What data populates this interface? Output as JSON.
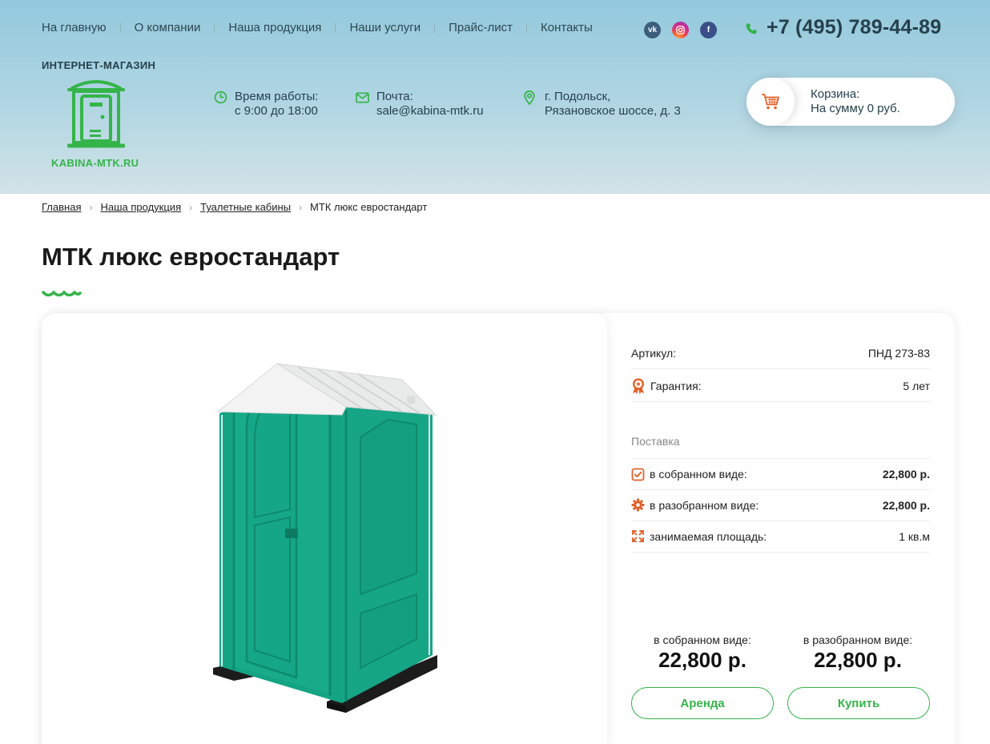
{
  "nav": {
    "items": [
      {
        "label": "На главную"
      },
      {
        "label": "О компании"
      },
      {
        "label": "Наша продукция"
      },
      {
        "label": "Наши услуги"
      },
      {
        "label": "Прайс-лист"
      },
      {
        "label": "Контакты"
      }
    ]
  },
  "social": {
    "vk": "vk",
    "instagram": "instagram-icon",
    "facebook": "f"
  },
  "phone": "+7 (495) 789-44-89",
  "logo": {
    "caption": "ИНТЕРНЕТ-МАГАЗИН",
    "text": "KABINA-MTK.RU",
    "color": "#35b44a"
  },
  "info": {
    "hours_label": "Время работы:",
    "hours_value": "с 9:00 до 18:00",
    "mail_label": "Почта:",
    "mail_value": "sale@kabina-mtk.ru",
    "addr_line1": "г. Подольск,",
    "addr_line2": "Рязановское шоссе, д. 3"
  },
  "cart": {
    "title": "Корзина:",
    "sum": "На сумму 0 руб."
  },
  "breadcrumb": [
    "Главная",
    "Наша продукция",
    "Туалетные кабины",
    "МТК люкс евростандарт"
  ],
  "product": {
    "title": "МТК люкс евростандарт",
    "article_label": "Артикул:",
    "article_value": "ПНД 273-83",
    "warranty_label": "Гарантия:",
    "warranty_value": "5 лет",
    "supply_label": "Поставка",
    "assembled_label": "в собранном виде:",
    "assembled_value": "22,800 р.",
    "disassembled_label": "в разобранном виде:",
    "disassembled_value": "22,800 р.",
    "area_label": "занимаемая площадь:",
    "area_value": "1 кв.м",
    "price_assembled_label": "в собранном виде:",
    "price_assembled": "22,800 р.",
    "price_disassembled_label": "в разобранном виде:",
    "price_disassembled": "22,800 р.",
    "rent_button": "Аренда",
    "buy_button": "Купить"
  },
  "colors": {
    "accent": "#35b44a",
    "icon_orange": "#e2622b",
    "cabin": "#14a383"
  }
}
